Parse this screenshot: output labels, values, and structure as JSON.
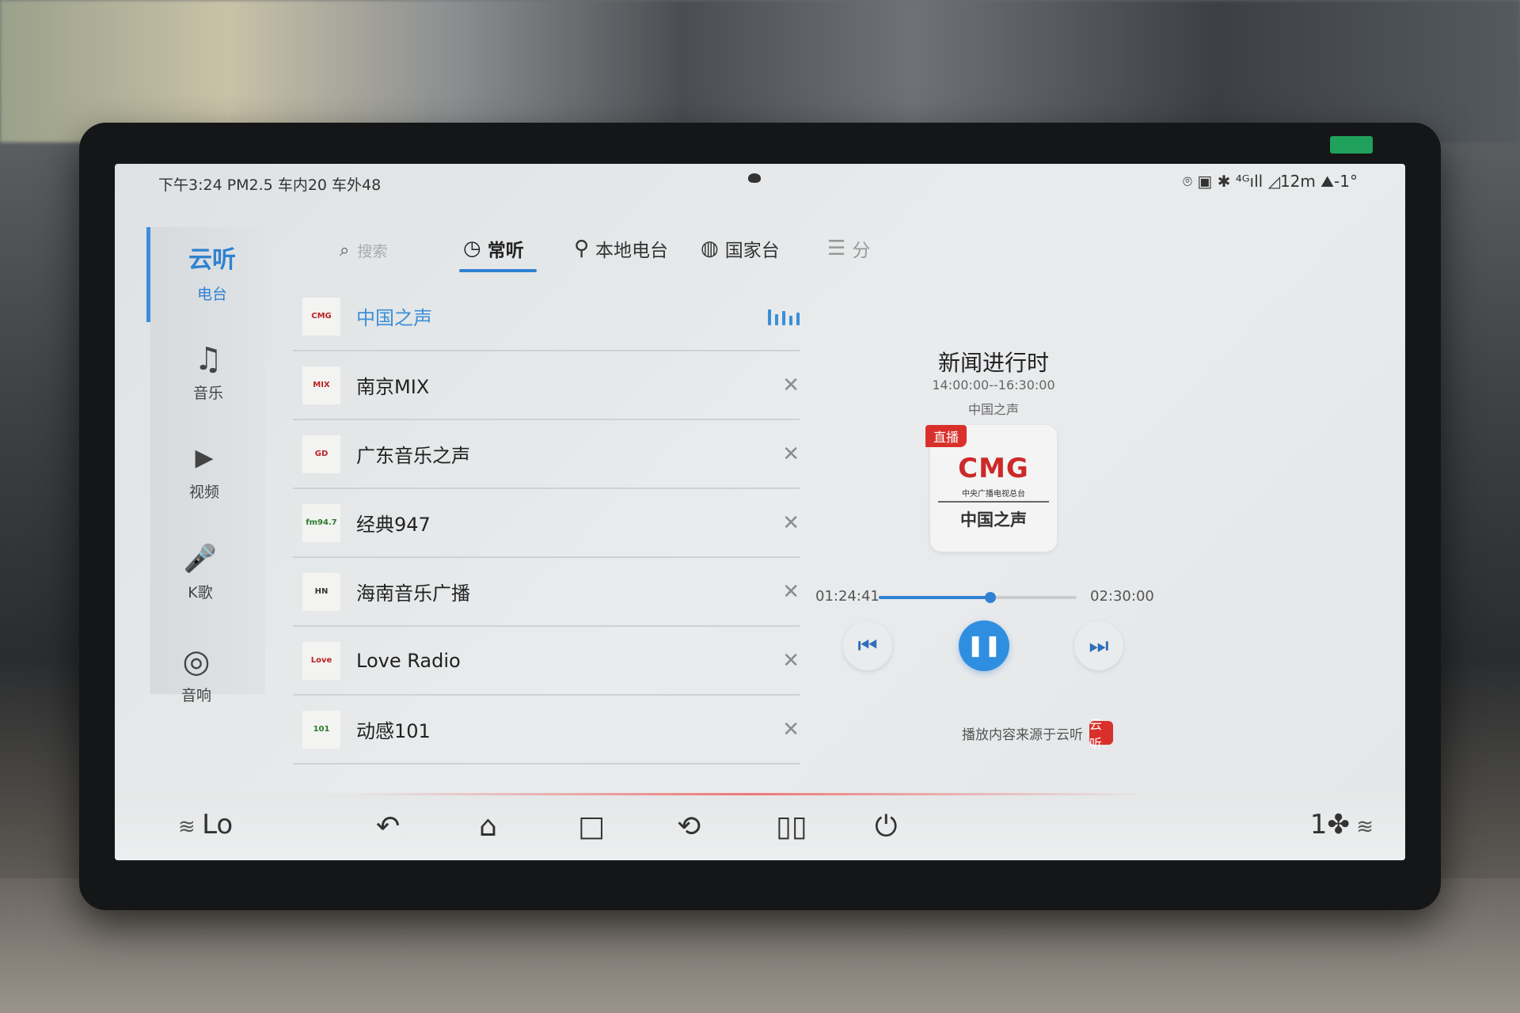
{
  "status": {
    "left_text": "下午3:24 PM2.5 车内20 车外48",
    "right_text": "⌾ ▣ ✱ ⁴ᴳıll ◿12m ⛰-1°"
  },
  "sidebar": {
    "items": [
      {
        "icon": "radio-icon",
        "glyph": "云听",
        "label": "电台"
      },
      {
        "icon": "music-note-icon",
        "glyph": "♫",
        "label": "音乐"
      },
      {
        "icon": "video-icon",
        "glyph": "▶",
        "label": "视频"
      },
      {
        "icon": "microphone-icon",
        "glyph": "🎤",
        "label": "K歌"
      },
      {
        "icon": "speaker-icon",
        "glyph": "◎",
        "label": "音响"
      }
    ]
  },
  "search": {
    "placeholder": "搜索"
  },
  "tabs": [
    {
      "label": "常听",
      "icon": "clock-icon"
    },
    {
      "label": "本地电台",
      "icon": "location-pin-icon"
    },
    {
      "label": "国家台",
      "icon": "globe-icon"
    },
    {
      "label": "分",
      "icon": "list-icon"
    }
  ],
  "stations": [
    {
      "name": "中国之声",
      "logo": "CMG",
      "playing": true
    },
    {
      "name": "南京MIX",
      "logo": "MIX"
    },
    {
      "name": "广东音乐之声",
      "logo": "GD"
    },
    {
      "name": "经典947",
      "logo": "fm94.7"
    },
    {
      "name": "海南音乐广播",
      "logo": "HN"
    },
    {
      "name": "Love Radio",
      "logo": "Love"
    },
    {
      "name": "动感101",
      "logo": "101"
    }
  ],
  "now_playing": {
    "program": "新闻进行时",
    "time_range": "14:00:00--16:30:00",
    "station": "中国之声",
    "live_badge": "直播",
    "cover_brand": "CMG",
    "cover_sub": "中央广播电视总台",
    "cover_name": "中国之声",
    "elapsed": "01:24:41",
    "total": "02:30:00",
    "progress": 0.564
  },
  "source": {
    "text": "播放内容来源于云听",
    "badge": "云听"
  },
  "dock": {
    "temp_left": "Lo",
    "fan_level": "1"
  },
  "colors": {
    "accent": "#2f82d2",
    "brand_red": "#d9302b"
  }
}
